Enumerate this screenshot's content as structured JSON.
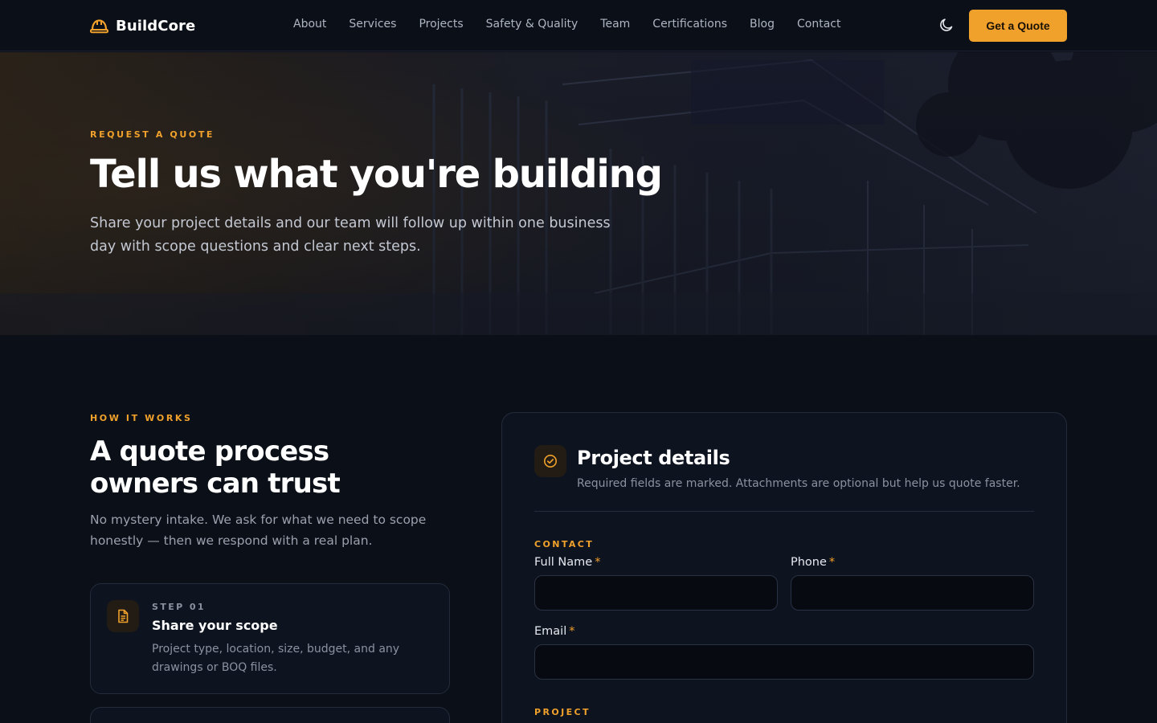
{
  "colors": {
    "accent": "#f0a12b",
    "background": "#0b0f17",
    "card": "#0e1320",
    "border": "#242b3a"
  },
  "nav": {
    "logo_icon": "hard-hat-icon",
    "brand": "BuildCore",
    "links": [
      "About",
      "Services",
      "Projects",
      "Safety & Quality",
      "Team",
      "Certifications",
      "Blog",
      "Contact"
    ],
    "theme_icon": "moon-icon",
    "cta": "Get a Quote"
  },
  "hero": {
    "eyebrow": "REQUEST A QUOTE",
    "title": "Tell us what you're building",
    "subtitle": "Share your project details and our team will follow up within one business day with scope questions and clear next steps."
  },
  "how": {
    "eyebrow": "HOW IT WORKS",
    "title": "A quote process owners can trust",
    "subtitle": "No mystery intake. We ask for what we need to scope honestly — then we respond with a real plan.",
    "steps": [
      {
        "icon": "document-icon",
        "number": "STEP 01",
        "title": "Share your scope",
        "description": "Project type, location, size, budget, and any drawings or BOQ files."
      }
    ]
  },
  "form": {
    "icon": "check-circle-icon",
    "title": "Project details",
    "subtitle": "Required fields are marked. Attachments are optional but help us quote faster.",
    "contact_section": "CONTACT",
    "project_section": "PROJECT",
    "required_mark": "*",
    "fields": {
      "full_name": {
        "label": "Full Name",
        "value": "",
        "placeholder": ""
      },
      "phone": {
        "label": "Phone",
        "value": "",
        "placeholder": ""
      },
      "email": {
        "label": "Email",
        "value": "",
        "placeholder": ""
      }
    }
  }
}
